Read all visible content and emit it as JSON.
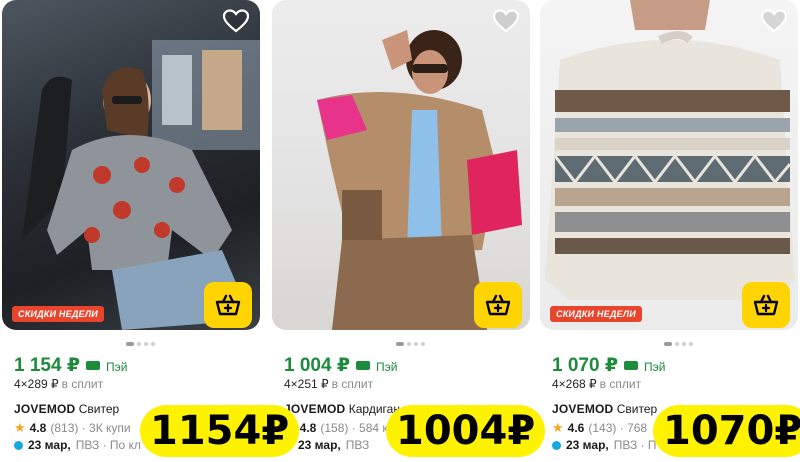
{
  "cards": [
    {
      "badge": "СКИДКИ НЕДЕЛИ",
      "price": "1 154 ₽",
      "pay_label": "Пэй",
      "split_amount": "4×289 ₽",
      "split_text": "в сплит",
      "brand": "JOVEMOD",
      "title": "Свитер",
      "rating": "4.8",
      "reviews_meta": "(813) · 3К купи",
      "delivery_date": "23 мар,",
      "delivery_meta": "ПВЗ · По кл",
      "big_price": "1154₽",
      "has_badge": true
    },
    {
      "badge": "",
      "price": "1 004 ₽",
      "pay_label": "Пэй",
      "split_amount": "4×251 ₽",
      "split_text": "в сплит",
      "brand": "JOVEMOD",
      "title": "Кардиган",
      "rating": "4.8",
      "reviews_meta": "(158) · 584 к",
      "delivery_date": "23 мар,",
      "delivery_meta": "ПВЗ",
      "big_price": "1004₽",
      "has_badge": false
    },
    {
      "badge": "СКИДКИ НЕДЕЛИ",
      "price": "1 070 ₽",
      "pay_label": "Пэй",
      "split_amount": "4×268 ₽",
      "split_text": "в сплит",
      "brand": "JOVEMOD",
      "title": "Свитер",
      "rating": "4.6",
      "reviews_meta": "(143) · 768",
      "delivery_date": "23 мар,",
      "delivery_meta": "ПВЗ · П",
      "big_price": "1070₽",
      "has_badge": true
    }
  ],
  "icons": {
    "favorite": "heart-outline-icon",
    "cart": "basket-icon",
    "pay": "card-icon",
    "rating": "star-icon",
    "delivery": "dot-icon"
  },
  "colors": {
    "price_green": "#1d8a3c",
    "cart_yellow": "#ffd400",
    "badge_red": "#e8452c",
    "highlight_yellow": "#fff200",
    "star": "#f5a623",
    "delivery_dot": "#16a8e0"
  }
}
